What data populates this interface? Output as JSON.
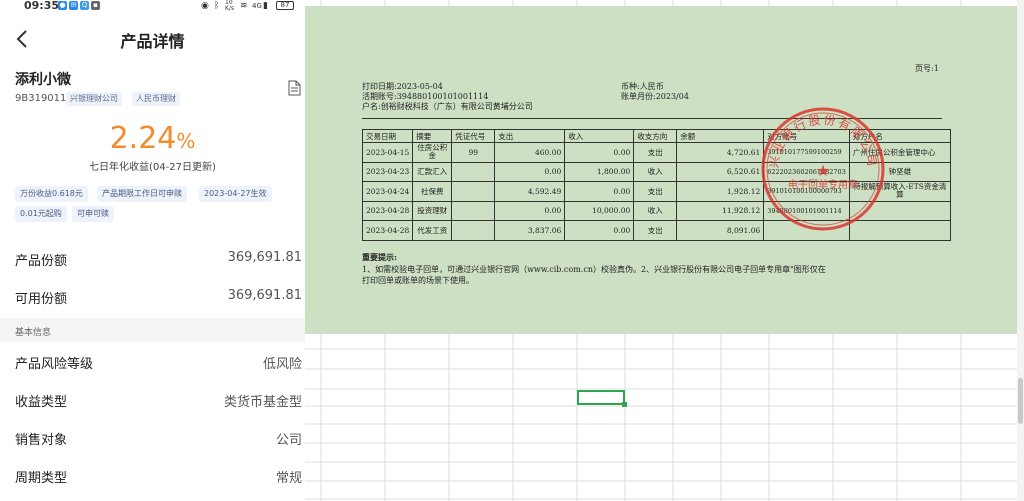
{
  "status_bar": {
    "time": "09:35",
    "network": "4G",
    "speed": "10 K/s",
    "battery": "87"
  },
  "nav": {
    "title": "产品详情"
  },
  "product": {
    "name": "添利小微",
    "code": "9B319011",
    "tags": [
      "兴银理财公司",
      "人民币理财"
    ],
    "yield_number": "2.24",
    "yield_unit": "%",
    "yield_desc": "七日年化收益(04-27日更新)",
    "chips": [
      "万份收益0.618元",
      "产品期限工作日可申赎",
      "2023-04-27生效",
      "0.01元起购",
      "可申可赎"
    ]
  },
  "holdings": [
    {
      "label": "产品份额",
      "value": "369,691.81"
    },
    {
      "label": "可用份额",
      "value": "369,691.81"
    }
  ],
  "basic_info": {
    "header": "基本信息",
    "rows": [
      {
        "label": "产品风险等级",
        "value": "低风险"
      },
      {
        "label": "收益类型",
        "value": "类货币基金型"
      },
      {
        "label": "销售对象",
        "value": "公司"
      },
      {
        "label": "周期类型",
        "value": "常规"
      }
    ]
  },
  "statement": {
    "page_no": "页号:1",
    "print_date": "打印日期:2023-05-04",
    "account": "活期账号:39488010010100​1114",
    "account_name": "户名:创裕财税科技（广东）有限公司黄埔分公司",
    "currency": "币种:人民币",
    "bill_month": "账单月份:2023/04",
    "columns": [
      "交易日期",
      "摘要",
      "凭证代号",
      "支出",
      "收入",
      "收支方向",
      "余额",
      "对方账号",
      "对方户名"
    ],
    "rows": [
      [
        "2023-04-15",
        "住房公积金",
        "99",
        "460.00",
        "0.00",
        "支出",
        "4,720.61",
        "391010177599100259",
        "广州住房公积金管理中心"
      ],
      [
        "2023-04-23",
        "汇款汇入",
        "",
        "0.00",
        "1,800.00",
        "收入",
        "6,520.61",
        "6222023602061282703",
        "钟坚雄"
      ],
      [
        "2023-04-24",
        "社保费",
        "",
        "4,592.49",
        "0.00",
        "支出",
        "1,928.12",
        "391010100100000793",
        "待报解预算收入-ETS资金清算"
      ],
      [
        "2023-04-28",
        "投资理财",
        "",
        "0.00",
        "10,000.00",
        "收入",
        "11,928.12",
        "394880100101001114",
        ""
      ],
      [
        "2023-04-28",
        "代发工资",
        "",
        "3,837.06",
        "0.00",
        "支出",
        "8,091.06",
        "",
        ""
      ]
    ],
    "notice_title": "重要提示:",
    "notice_line1": "1、如需校验电子回单，可通过兴业银行官网（www.cib.com.cn）校验真伪。2、兴业银行股份有限公司电子回单专用章\"图形仅在",
    "notice_line2": "打印回单或账单的场景下使用。",
    "stamp_text": "兴业银行股份有限公司",
    "stamp_bottom": "电子回单专用章"
  },
  "colors": {
    "accent_orange": "#f08c2c",
    "chip_bg": "#eef2fa",
    "statement_bg": "#cde0c4",
    "stamp_red": "#d9352f",
    "selection_green": "#2fa44f"
  }
}
